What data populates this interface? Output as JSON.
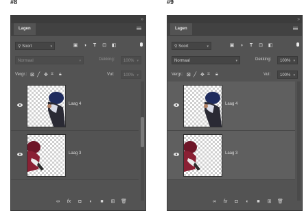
{
  "panels": [
    {
      "step": "#8",
      "tab": "Lagen",
      "filter": {
        "label": "Soort"
      },
      "blend": {
        "mode": "Normaal",
        "opacity_label": "Dekking:",
        "opacity_value": "100%"
      },
      "lock": {
        "label": "Vergr.:",
        "fill_label": "Vul:",
        "fill_value": "100%"
      },
      "layers": [
        {
          "name": "Laag 4"
        },
        {
          "name": "Laag 3"
        }
      ]
    },
    {
      "step": "#9",
      "tab": "Lagen",
      "filter": {
        "label": "Soort"
      },
      "blend": {
        "mode": "Normaal",
        "opacity_label": "Dekking:",
        "opacity_value": "100%"
      },
      "lock": {
        "label": "Vergr.:",
        "fill_label": "Vul:",
        "fill_value": "100%"
      },
      "layers": [
        {
          "name": "Laag 4"
        },
        {
          "name": "Laag 3"
        }
      ]
    }
  ],
  "colors": {
    "panel": "#535353",
    "header": "#3c3c3c",
    "tabbar": "#424242"
  }
}
